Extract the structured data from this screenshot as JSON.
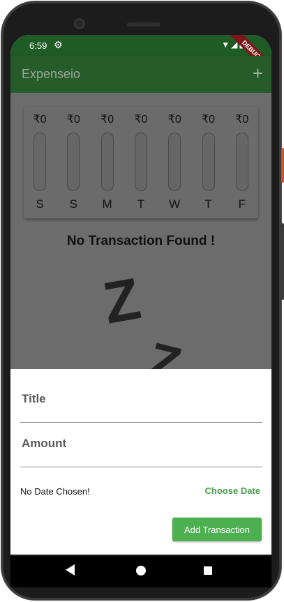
{
  "status_bar": {
    "time": "6:59",
    "gear_icon": "gear-icon",
    "signal_icons": "wifi-icon cellular-icon battery-icon",
    "debug_banner": "DEBUG"
  },
  "app_bar": {
    "title": "Expenseio",
    "add_icon": "+"
  },
  "chart_data": {
    "type": "bar",
    "categories": [
      "S",
      "S",
      "M",
      "T",
      "W",
      "T",
      "F"
    ],
    "amounts": [
      "₹0",
      "₹0",
      "₹0",
      "₹0",
      "₹0",
      "₹0",
      "₹0"
    ],
    "values": [
      0,
      0,
      0,
      0,
      0,
      0,
      0
    ]
  },
  "empty_state": {
    "text": "No Transaction Found !",
    "illustration": "Z Z"
  },
  "sheet": {
    "title_placeholder": "Title",
    "amount_placeholder": "Amount",
    "date_label": "No Date Chosen!",
    "choose_date_label": "Choose Date",
    "submit_label": "Add Transaction"
  },
  "nav": {
    "back_icon": "back-icon",
    "home_icon": "home-icon",
    "recents_icon": "recents-icon"
  },
  "colors": {
    "app_bar": "#255c29",
    "accent": "#4caf50",
    "dim_overlay": "#6c6c6c"
  }
}
